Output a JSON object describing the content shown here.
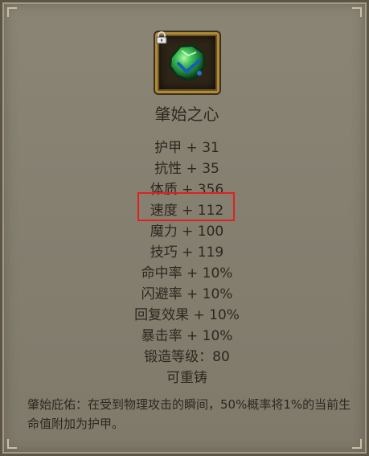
{
  "item": {
    "name": "肇始之心",
    "icon": "green-gem-icon",
    "locked_icon": "lock-icon"
  },
  "stats": [
    "护甲 + 31",
    "抗性 + 35",
    "体质 + 356",
    "速度 + 112",
    "魔力 + 100",
    "技巧 + 119",
    "命中率 + 10%",
    "闪避率 + 10%",
    "回复效果 + 10%",
    "暴击率 + 10%",
    "锻造等级：80",
    "可重铸"
  ],
  "description": "肇始庇佑：在受到物理攻击的瞬间，50%概率将1%的当前生命值附加为护甲。",
  "colors": {
    "panel": "#857f70",
    "frame_gold": "#b08a35",
    "highlight": "#e02020",
    "gem_green": "#2fa84a"
  }
}
